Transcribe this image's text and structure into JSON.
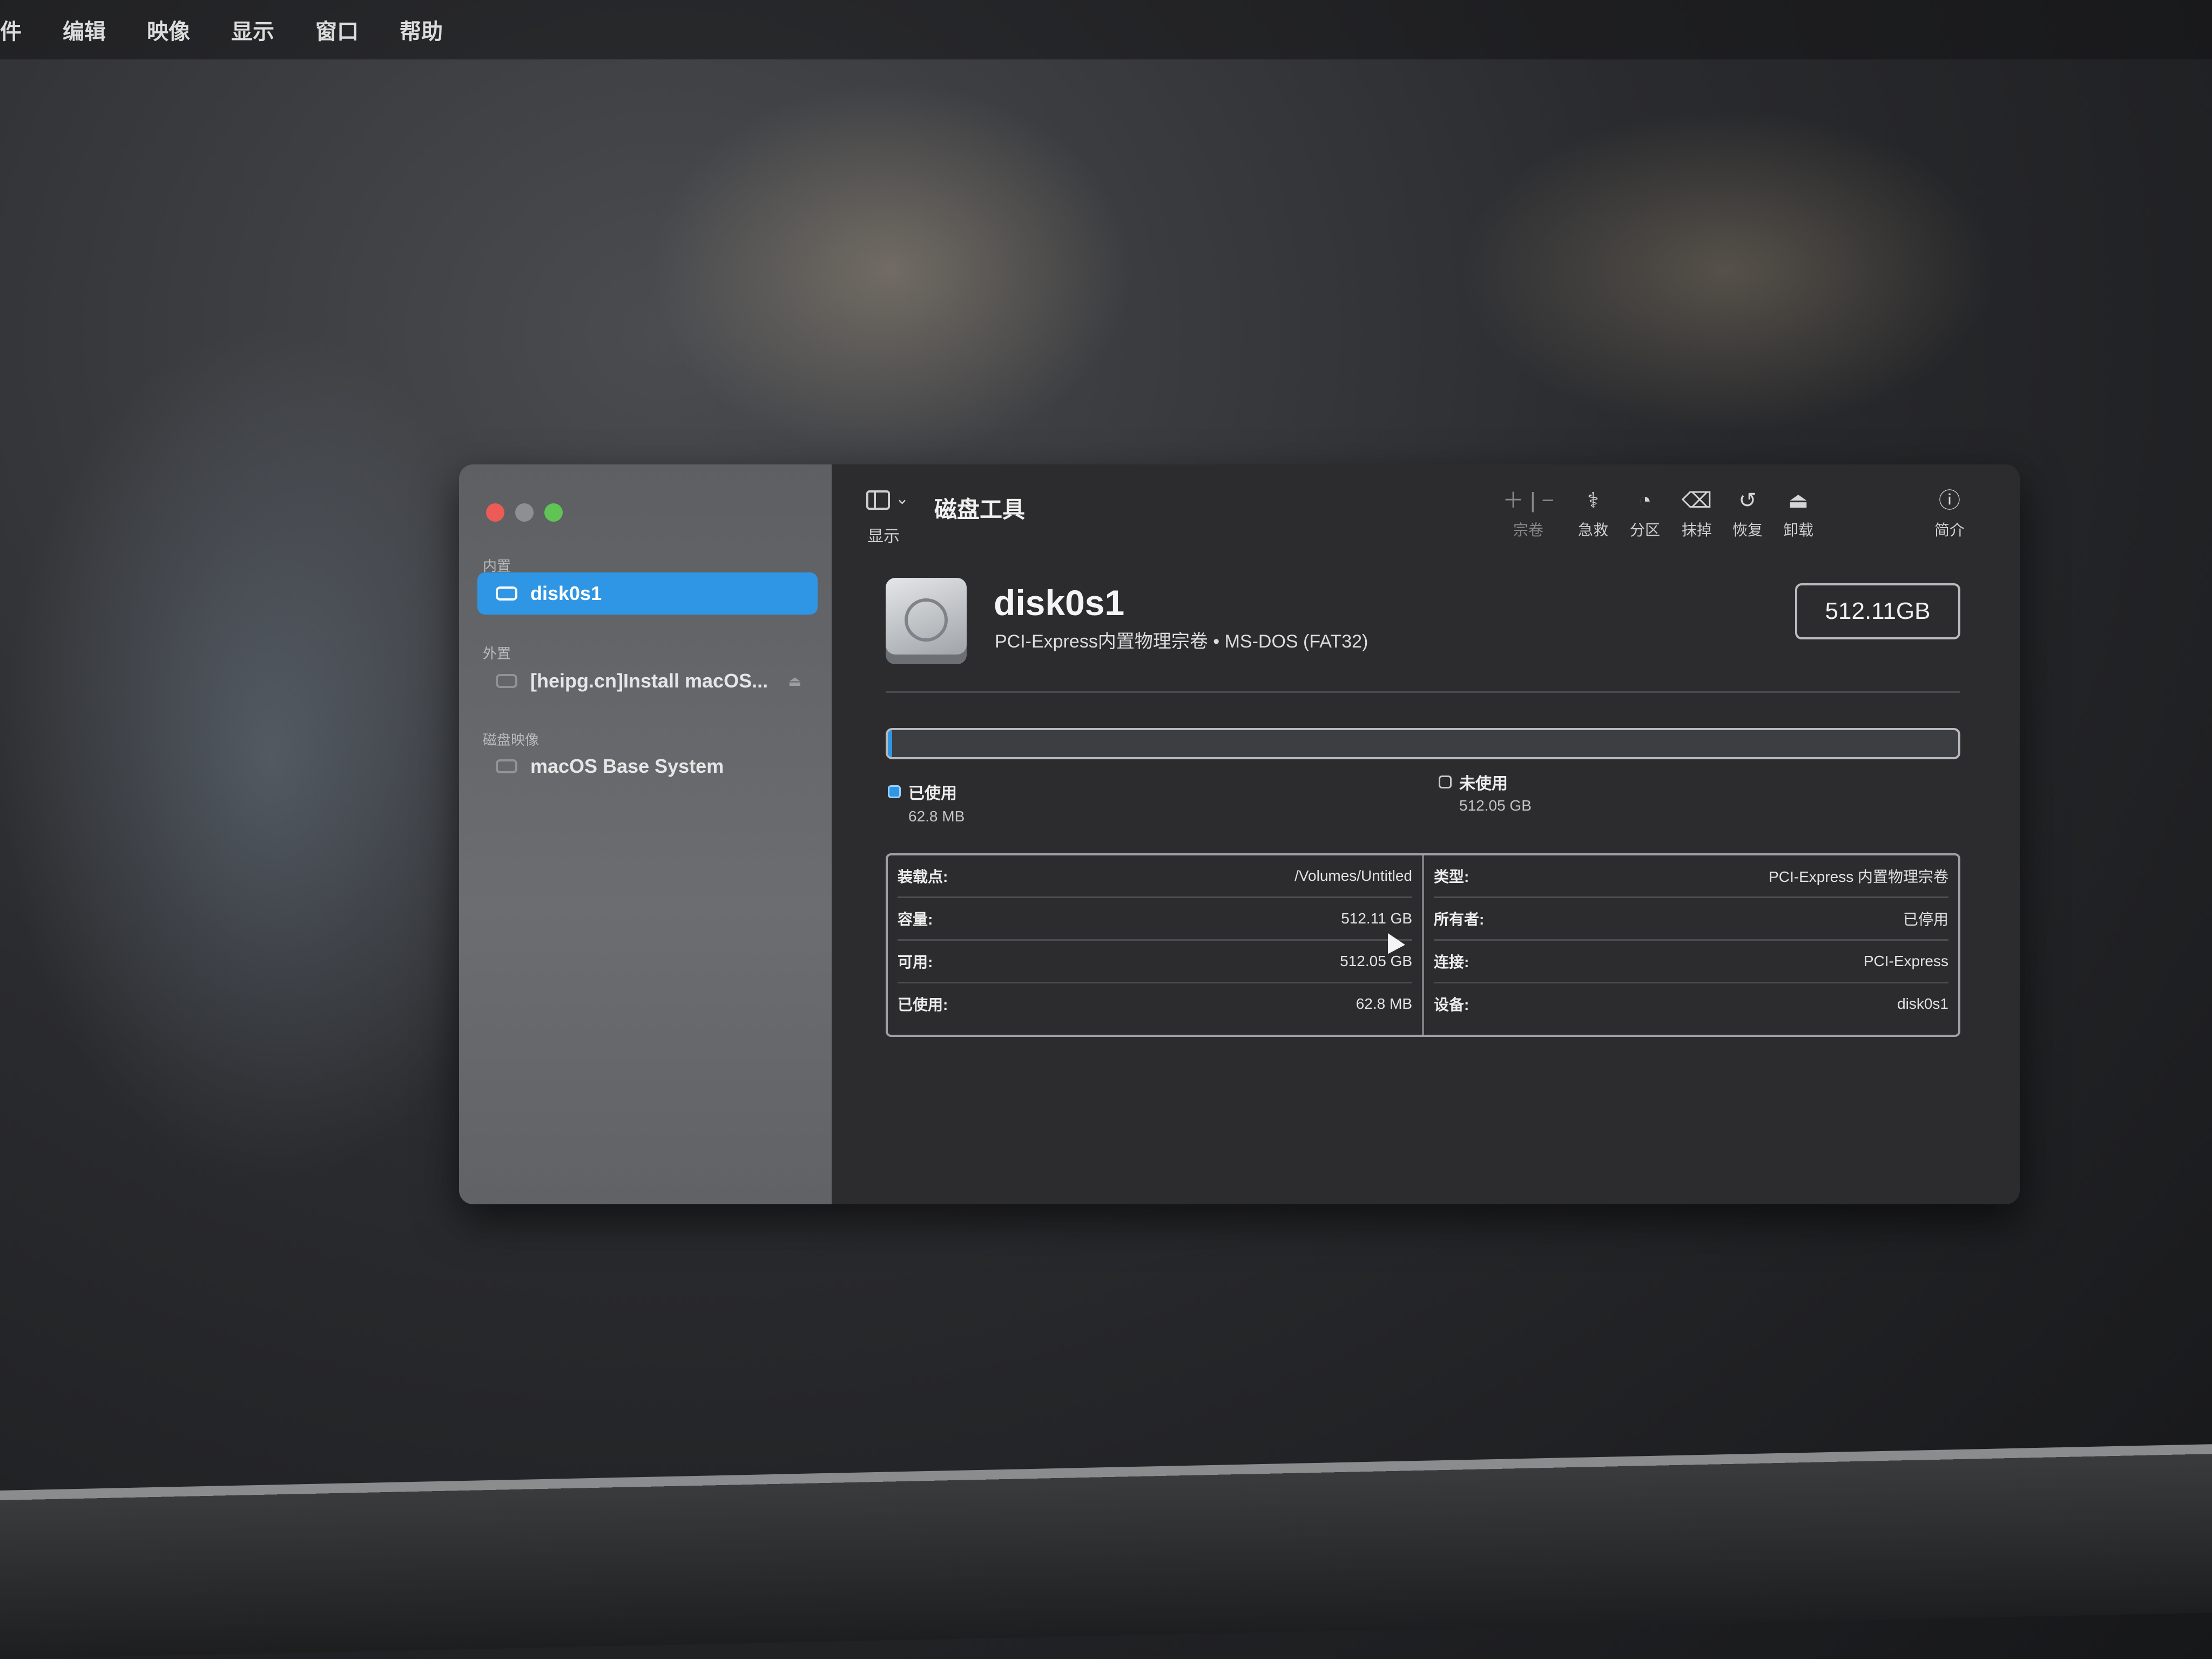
{
  "menubar": {
    "items": [
      "件",
      "编辑",
      "映像",
      "显示",
      "窗口",
      "帮助"
    ]
  },
  "sidebar": {
    "sections": {
      "internal": "内置",
      "external": "外置",
      "images": "磁盘映像"
    },
    "items": [
      {
        "label": "disk0s1",
        "selected": true
      },
      {
        "label": "[heipg.cn]Install macOS..."
      },
      {
        "label": "macOS Base System"
      }
    ]
  },
  "toolbar": {
    "show_label": "显示",
    "title": "磁盘工具",
    "volume_label": "宗卷",
    "firstaid_label": "急救",
    "partition_label": "分区",
    "erase_label": "抹掉",
    "restore_label": "恢复",
    "unmount_label": "卸载",
    "info_label": "简介"
  },
  "disk": {
    "name": "disk0s1",
    "subtitle": "PCI-Express内置物理宗卷 • MS-DOS (FAT32)",
    "size": "512.11GB"
  },
  "usage": {
    "used_fraction": 0.000123,
    "used_label": "已使用",
    "used_value": "62.8 MB",
    "free_label": "未使用",
    "free_value": "512.05 GB"
  },
  "info": {
    "left": [
      {
        "key": "装载点:",
        "value": "/Volumes/Untitled"
      },
      {
        "key": "容量:",
        "value": "512.11 GB"
      },
      {
        "key": "可用:",
        "value": "512.05 GB"
      },
      {
        "key": "已使用:",
        "value": "62.8 MB"
      }
    ],
    "right": [
      {
        "key": "类型:",
        "value": "PCI-Express 内置物理宗卷"
      },
      {
        "key": "所有者:",
        "value": "已停用"
      },
      {
        "key": "连接:",
        "value": "PCI-Express"
      },
      {
        "key": "设备:",
        "value": "disk0s1"
      }
    ]
  },
  "colors": {
    "accent": "#2f96e5",
    "close": "#ec5b56",
    "zoom": "#5fc454"
  }
}
